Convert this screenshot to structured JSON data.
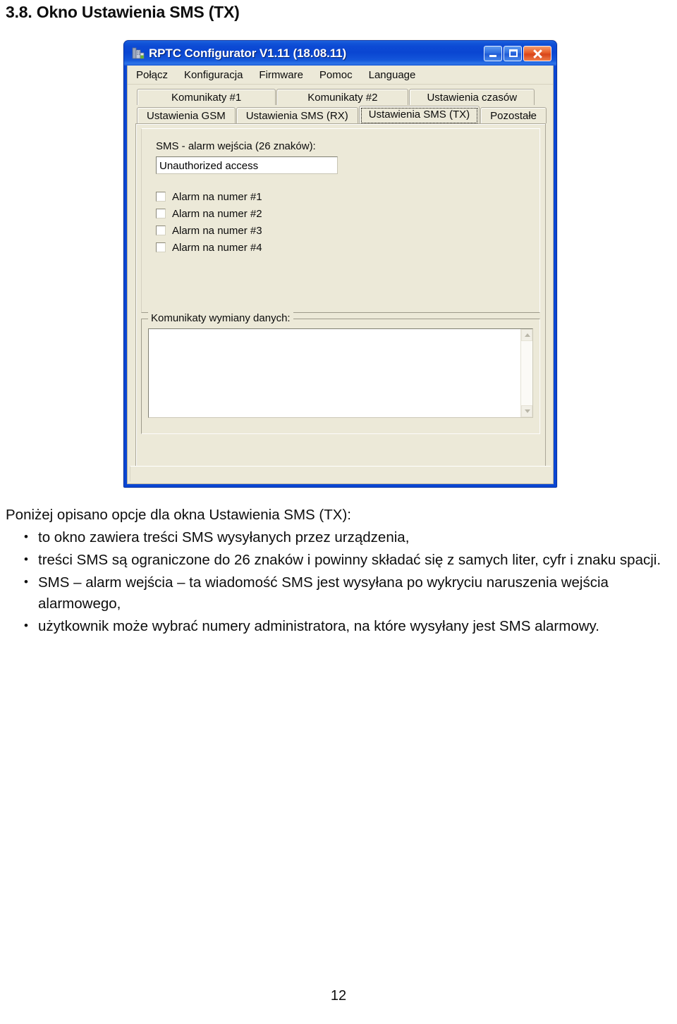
{
  "document": {
    "heading": "3.8. Okno Ustawienia SMS (TX)",
    "lead": "Poniżej opisano opcje dla okna Ustawienia SMS (TX):",
    "bullets": [
      "to okno zawiera treści SMS wysyłanych przez urządzenia,",
      "treści SMS są ograniczone do 26 znaków i powinny składać się z samych liter, cyfr i znaku spacji.",
      "SMS – alarm wejścia – ta wiadomość SMS jest wysyłana po wykryciu naruszenia wejścia alarmowego,",
      "użytkownik może wybrać numery administratora, na które wysyłany jest SMS alarmowy."
    ],
    "page_number": "12"
  },
  "app_window": {
    "title": "RPTC Configurator V1.11 (18.08.11)",
    "icon": "building-icon",
    "titlebar_color": "#0a46d2",
    "client_color": "#ece9d8",
    "caption_buttons": [
      {
        "name": "minimize-button",
        "glyph": "minimize-icon"
      },
      {
        "name": "maximize-button",
        "glyph": "maximize-icon"
      },
      {
        "name": "close-button",
        "glyph": "close-icon",
        "color": "#e8602c"
      }
    ],
    "menu": [
      {
        "label": "Połącz"
      },
      {
        "label": "Konfiguracja"
      },
      {
        "label": "Firmware"
      },
      {
        "label": "Pomoc"
      },
      {
        "label": "Language"
      }
    ],
    "tabs_row1": [
      {
        "label": "Komunikaty #1",
        "selected": false
      },
      {
        "label": "Komunikaty #2",
        "selected": false
      },
      {
        "label": "Ustawienia czasów",
        "selected": false
      }
    ],
    "tabs_row2": [
      {
        "label": "Ustawienia GSM",
        "selected": false
      },
      {
        "label": "Ustawienia SMS (RX)",
        "selected": false
      },
      {
        "label": "Ustawienia SMS (TX)",
        "selected": true
      },
      {
        "label": "Pozostałe",
        "selected": false
      }
    ],
    "tab_page": {
      "sms_field_label": "SMS - alarm wejścia (26 znaków):",
      "sms_field_value": "Unauthorized access",
      "checkboxes": [
        {
          "label": "Alarm na numer #1",
          "checked": false
        },
        {
          "label": "Alarm na numer #2",
          "checked": false
        },
        {
          "label": "Alarm na numer #3",
          "checked": false
        },
        {
          "label": "Alarm na numer #4",
          "checked": false
        }
      ]
    },
    "log_group": {
      "caption": "Komunikaty wymiany danych:",
      "content": ""
    },
    "statusbar_text": ""
  }
}
